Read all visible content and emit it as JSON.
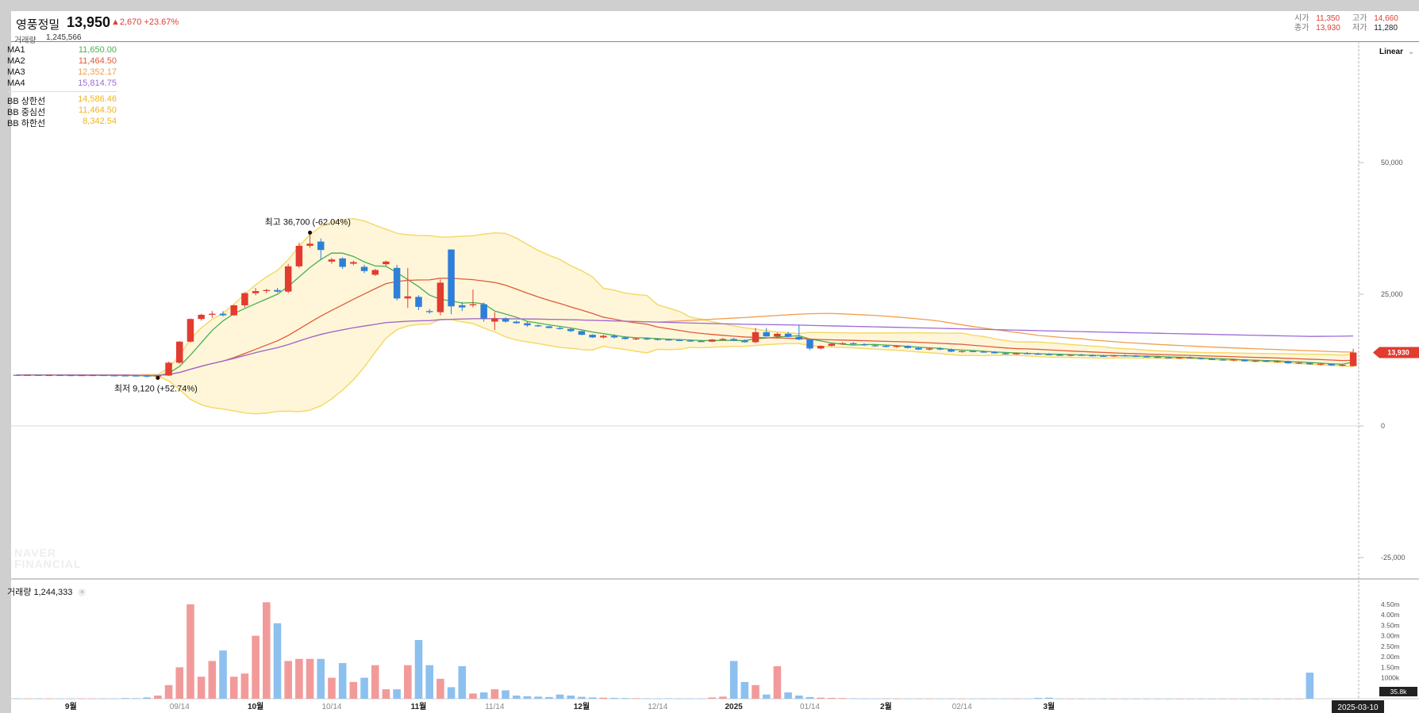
{
  "header": {
    "stock_name": "영풍정밀",
    "price": "13,950",
    "change": "▲2,670 +23.67%",
    "volume_label": "거래량",
    "volume_value": "1,245,566",
    "ohlc": {
      "open_label": "시가",
      "open_value": "11,350",
      "high_label": "고가",
      "high_value": "14,660",
      "close_label": "종가",
      "close_value": "13,930",
      "low_label": "저가",
      "low_value": "11,280"
    }
  },
  "legend": [
    {
      "name": "MA1",
      "value": "11,650.00",
      "color": "#4caf50"
    },
    {
      "name": "MA2",
      "value": "11,464.50",
      "color": "#e05a3c"
    },
    {
      "name": "MA3",
      "value": "12,352.17",
      "color": "#f29d4b"
    },
    {
      "name": "MA4",
      "value": "15,814.75",
      "color": "#9c6bd6"
    },
    {
      "name": "BB 상한선",
      "value": "14,586.46",
      "color": "#f2b31e"
    },
    {
      "name": "BB 중심선",
      "value": "11,464.50",
      "color": "#f2b31e"
    },
    {
      "name": "BB 하한선",
      "value": "8,342.54",
      "color": "#f2b31e"
    }
  ],
  "scale_mode": "Linear",
  "watermark": [
    "NAVER",
    "FINANCIAL"
  ],
  "volume_panel": {
    "label": "거래량",
    "value": "1,244,333"
  },
  "colors": {
    "up": "#e23b2f",
    "down": "#2f7fd8",
    "vol_up": "#f29a9a",
    "vol_down": "#8cc0ef",
    "band_fill": "#fff6d9",
    "band_line": "#f4d96a"
  },
  "chart_data": {
    "type": "candlestick",
    "y_ticks": [
      "50,000",
      "25,000",
      "0",
      "-25,000"
    ],
    "volume_ticks": [
      "4.50m",
      "4.00m",
      "3.50m",
      "3.00m",
      "2.50m",
      "2.00m",
      "1.50m",
      "1000k"
    ],
    "x_ticks": [
      "9월",
      "09/14",
      "10월",
      "10/14",
      "11월",
      "11/14",
      "12월",
      "12/14",
      "2025",
      "01/14",
      "2월",
      "02/14",
      "3월"
    ],
    "current_date": "2025-03-10",
    "current_price_label": "13,930",
    "current_volume_label": "35.8k",
    "annotations": [
      {
        "text": "최고 36,700 (-62.04%)",
        "value": 36700
      },
      {
        "text": "최저 9,120 (+52.74%)",
        "value": 9120
      }
    ],
    "candles": [
      [
        9700,
        9750,
        9600,
        9650
      ],
      [
        9650,
        9700,
        9600,
        9680
      ],
      [
        9680,
        9720,
        9620,
        9640
      ],
      [
        9640,
        9700,
        9600,
        9660
      ],
      [
        9660,
        9700,
        9620,
        9640
      ],
      [
        9640,
        9680,
        9600,
        9620
      ],
      [
        9620,
        9660,
        9580,
        9640
      ],
      [
        9640,
        9700,
        9600,
        9650
      ],
      [
        9650,
        9680,
        9580,
        9600
      ],
      [
        9600,
        9640,
        9550,
        9580
      ],
      [
        9580,
        9620,
        9540,
        9560
      ],
      [
        9560,
        9600,
        9500,
        9540
      ],
      [
        9540,
        9560,
        9200,
        9400
      ],
      [
        9400,
        9600,
        9120,
        9560
      ],
      [
        9560,
        12200,
        9500,
        12000
      ],
      [
        12000,
        16100,
        11800,
        16000
      ],
      [
        16000,
        20400,
        15800,
        20300
      ],
      [
        20300,
        21300,
        20000,
        21100
      ],
      [
        21100,
        21800,
        20500,
        21300
      ],
      [
        21300,
        21800,
        20800,
        21000
      ],
      [
        21000,
        23000,
        20900,
        22900
      ],
      [
        22900,
        25400,
        22500,
        25200
      ],
      [
        25200,
        26200,
        24800,
        25600
      ],
      [
        25600,
        26000,
        25200,
        25800
      ],
      [
        25800,
        26200,
        25300,
        25500
      ],
      [
        25500,
        30800,
        25200,
        30300
      ],
      [
        30300,
        34800,
        30000,
        34200
      ],
      [
        34200,
        36700,
        33800,
        34600
      ],
      [
        35000,
        35600,
        31500,
        33400
      ],
      [
        31200,
        31900,
        30800,
        31600
      ],
      [
        31800,
        32000,
        29800,
        30200
      ],
      [
        30800,
        31400,
        30500,
        31100
      ],
      [
        30200,
        30600,
        29000,
        29400
      ],
      [
        28700,
        29800,
        28500,
        29600
      ],
      [
        30700,
        31400,
        30400,
        31200
      ],
      [
        30000,
        30600,
        23800,
        24200
      ],
      [
        24200,
        30000,
        22400,
        24600
      ],
      [
        24500,
        24800,
        22000,
        22600
      ],
      [
        21800,
        22200,
        21300,
        21600
      ],
      [
        21600,
        27800,
        21000,
        27200
      ],
      [
        33500,
        33500,
        21200,
        22700
      ],
      [
        22900,
        23500,
        21800,
        22500
      ],
      [
        22900,
        25900,
        22500,
        23100
      ],
      [
        23100,
        23400,
        19800,
        20400
      ],
      [
        19800,
        21600,
        18200,
        20400
      ],
      [
        20400,
        20600,
        19600,
        19800
      ],
      [
        19800,
        20000,
        19400,
        19500
      ],
      [
        19500,
        19800,
        18800,
        19100
      ],
      [
        19100,
        19300,
        18800,
        18900
      ],
      [
        18900,
        19000,
        18500,
        18600
      ],
      [
        18600,
        18800,
        18300,
        18400
      ],
      [
        18400,
        18600,
        17800,
        18000
      ],
      [
        18000,
        18100,
        17200,
        17300
      ],
      [
        17300,
        17400,
        16700,
        16800
      ],
      [
        16800,
        17300,
        16600,
        17100
      ],
      [
        17100,
        17400,
        16600,
        16800
      ],
      [
        16800,
        17000,
        16400,
        16500
      ],
      [
        16500,
        16800,
        16300,
        16600
      ],
      [
        16600,
        16800,
        16300,
        16500
      ],
      [
        16500,
        16700,
        16200,
        16400
      ],
      [
        16400,
        16600,
        16200,
        16300
      ],
      [
        16300,
        16500,
        16100,
        16200
      ],
      [
        16200,
        16400,
        16000,
        16100
      ],
      [
        16100,
        16300,
        15900,
        16000
      ],
      [
        16000,
        16500,
        15900,
        16400
      ],
      [
        16400,
        16700,
        16200,
        16500
      ],
      [
        16500,
        16700,
        16100,
        16200
      ],
      [
        16200,
        16400,
        15800,
        15900
      ],
      [
        15900,
        18600,
        15700,
        17800
      ],
      [
        17800,
        18600,
        16900,
        17000
      ],
      [
        17000,
        17700,
        16600,
        17500
      ],
      [
        17500,
        17900,
        16800,
        16900
      ],
      [
        16900,
        19200,
        16300,
        16400
      ],
      [
        16400,
        16500,
        14400,
        14700
      ],
      [
        14700,
        15300,
        14500,
        15200
      ],
      [
        15200,
        15700,
        15100,
        15600
      ],
      [
        15600,
        15900,
        15400,
        15700
      ],
      [
        15700,
        15900,
        15400,
        15500
      ],
      [
        15500,
        15700,
        15200,
        15300
      ],
      [
        15300,
        15500,
        15000,
        15200
      ],
      [
        15200,
        15400,
        14900,
        15000
      ],
      [
        15000,
        15300,
        14800,
        15200
      ],
      [
        15200,
        15300,
        14700,
        14800
      ],
      [
        14800,
        15000,
        14400,
        14500
      ],
      [
        14500,
        14800,
        14300,
        14700
      ],
      [
        14700,
        14900,
        14400,
        14500
      ],
      [
        14500,
        14700,
        14000,
        14100
      ],
      [
        14100,
        14300,
        13900,
        14200
      ],
      [
        14200,
        14400,
        14000,
        14100
      ],
      [
        14100,
        14300,
        13900,
        14000
      ],
      [
        14000,
        14200,
        13700,
        13800
      ],
      [
        13800,
        14000,
        13500,
        13600
      ],
      [
        13600,
        13900,
        13500,
        13800
      ],
      [
        13800,
        14000,
        13600,
        13700
      ],
      [
        13700,
        13900,
        13500,
        13600
      ],
      [
        13600,
        13800,
        13400,
        13500
      ],
      [
        13500,
        13700,
        13300,
        13400
      ],
      [
        13400,
        13600,
        13200,
        13500
      ],
      [
        13500,
        13700,
        13300,
        13400
      ],
      [
        13400,
        13600,
        13200,
        13300
      ],
      [
        13300,
        13500,
        13100,
        13200
      ],
      [
        13200,
        13500,
        13100,
        13400
      ],
      [
        13400,
        13600,
        13200,
        13300
      ],
      [
        13300,
        13500,
        13100,
        13200
      ],
      [
        13200,
        13400,
        13000,
        13100
      ],
      [
        13100,
        13300,
        12900,
        13000
      ],
      [
        13000,
        13200,
        12800,
        12900
      ],
      [
        12900,
        13100,
        12700,
        13000
      ],
      [
        13000,
        13200,
        12800,
        12900
      ],
      [
        12900,
        13000,
        12600,
        12700
      ],
      [
        12700,
        12900,
        12500,
        12600
      ],
      [
        12600,
        12800,
        12400,
        12500
      ],
      [
        12500,
        12700,
        12300,
        12600
      ],
      [
        12600,
        12700,
        12200,
        12300
      ],
      [
        12300,
        12500,
        12100,
        12400
      ],
      [
        12400,
        12500,
        12100,
        12200
      ],
      [
        12200,
        12400,
        12000,
        12300
      ],
      [
        12300,
        12400,
        11800,
        11900
      ],
      [
        11900,
        12100,
        11700,
        12000
      ],
      [
        12000,
        12100,
        11600,
        11700
      ],
      [
        11700,
        11900,
        11500,
        11800
      ],
      [
        11800,
        11900,
        11400,
        11500
      ],
      [
        11500,
        11700,
        11300,
        11600
      ],
      [
        11350,
        14660,
        11280,
        13930
      ]
    ],
    "volume": [
      20000,
      15000,
      18000,
      16000,
      14000,
      15000,
      12000,
      15000,
      16000,
      14000,
      30000,
      25000,
      60000,
      150000,
      650000,
      1500000,
      4500000,
      1050000,
      1800000,
      2300000,
      1050000,
      1200000,
      3000000,
      4600000,
      3600000,
      1800000,
      1900000,
      1900000,
      1900000,
      1000000,
      1700000,
      800000,
      1000000,
      1600000,
      450000,
      450000,
      1600000,
      2800000,
      1600000,
      950000,
      550000,
      1550000,
      250000,
      300000,
      450000,
      400000,
      150000,
      120000,
      100000,
      80000,
      200000,
      150000,
      90000,
      60000,
      50000,
      40000,
      30000,
      25000,
      20000,
      15000,
      20000,
      15000,
      12000,
      10000,
      60000,
      100000,
      1800000,
      800000,
      650000,
      200000,
      1550000,
      300000,
      150000,
      80000,
      50000,
      40000,
      30000,
      20000,
      15000,
      12000,
      10000,
      8000,
      10000,
      8000,
      6000,
      5000,
      6000,
      5000,
      4000,
      3000,
      10000,
      8000,
      6000,
      5000,
      40000,
      50000,
      4000,
      3000,
      2000,
      3000,
      2000,
      3000,
      2000,
      2000,
      2000,
      2000,
      1000,
      2000,
      1000,
      1000,
      1000,
      1000,
      1000,
      1000,
      1000,
      1000,
      1000,
      1000,
      1000,
      1244333
    ]
  }
}
